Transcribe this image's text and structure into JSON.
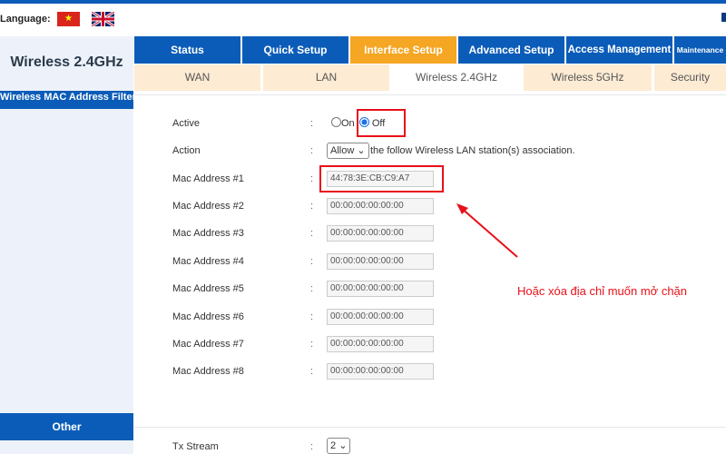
{
  "header": {
    "language_label": "Language:",
    "flags": [
      "vietnam-flag",
      "uk-flag"
    ]
  },
  "sidebar": {
    "title": "Wireless 2.4GHz",
    "items": [
      {
        "label": "Wireless MAC Address Filter"
      },
      {
        "label": "Other"
      }
    ]
  },
  "nav": {
    "tabs": [
      "Status",
      "Quick Setup",
      "Interface Setup",
      "Advanced Setup",
      "Access Management",
      "Maintenance"
    ],
    "active": "Interface Setup"
  },
  "subnav": {
    "tabs": [
      "WAN",
      "LAN",
      "Wireless 2.4GHz",
      "Wireless 5GHz",
      "Security"
    ],
    "active": "Wireless 2.4GHz"
  },
  "form": {
    "active": {
      "label": "Active",
      "on": "On",
      "off": "Off",
      "value": "Off"
    },
    "action": {
      "label": "Action",
      "value": "Allow",
      "suffix": "the follow Wireless LAN station(s) association."
    },
    "macs": [
      {
        "label": "Mac Address #1",
        "value": "44:78:3E:CB:C9:A7"
      },
      {
        "label": "Mac Address #2",
        "value": "00:00:00:00:00:00"
      },
      {
        "label": "Mac Address #3",
        "value": "00:00:00:00:00:00"
      },
      {
        "label": "Mac Address #4",
        "value": "00:00:00:00:00:00"
      },
      {
        "label": "Mac Address #5",
        "value": "00:00:00:00:00:00"
      },
      {
        "label": "Mac Address #6",
        "value": "00:00:00:00:00:00"
      },
      {
        "label": "Mac Address #7",
        "value": "00:00:00:00:00:00"
      },
      {
        "label": "Mac Address #8",
        "value": "00:00:00:00:00:00"
      }
    ],
    "tx_stream": {
      "label": "Tx Stream",
      "value": "2"
    }
  },
  "annotation": {
    "text": "Hoặc xóa địa chỉ muốn mở chặn",
    "color": "#e8101a"
  },
  "colors": {
    "primary": "#0b5cb8",
    "active_tab": "#f5a623",
    "subtab_bg": "#fdebd3"
  }
}
